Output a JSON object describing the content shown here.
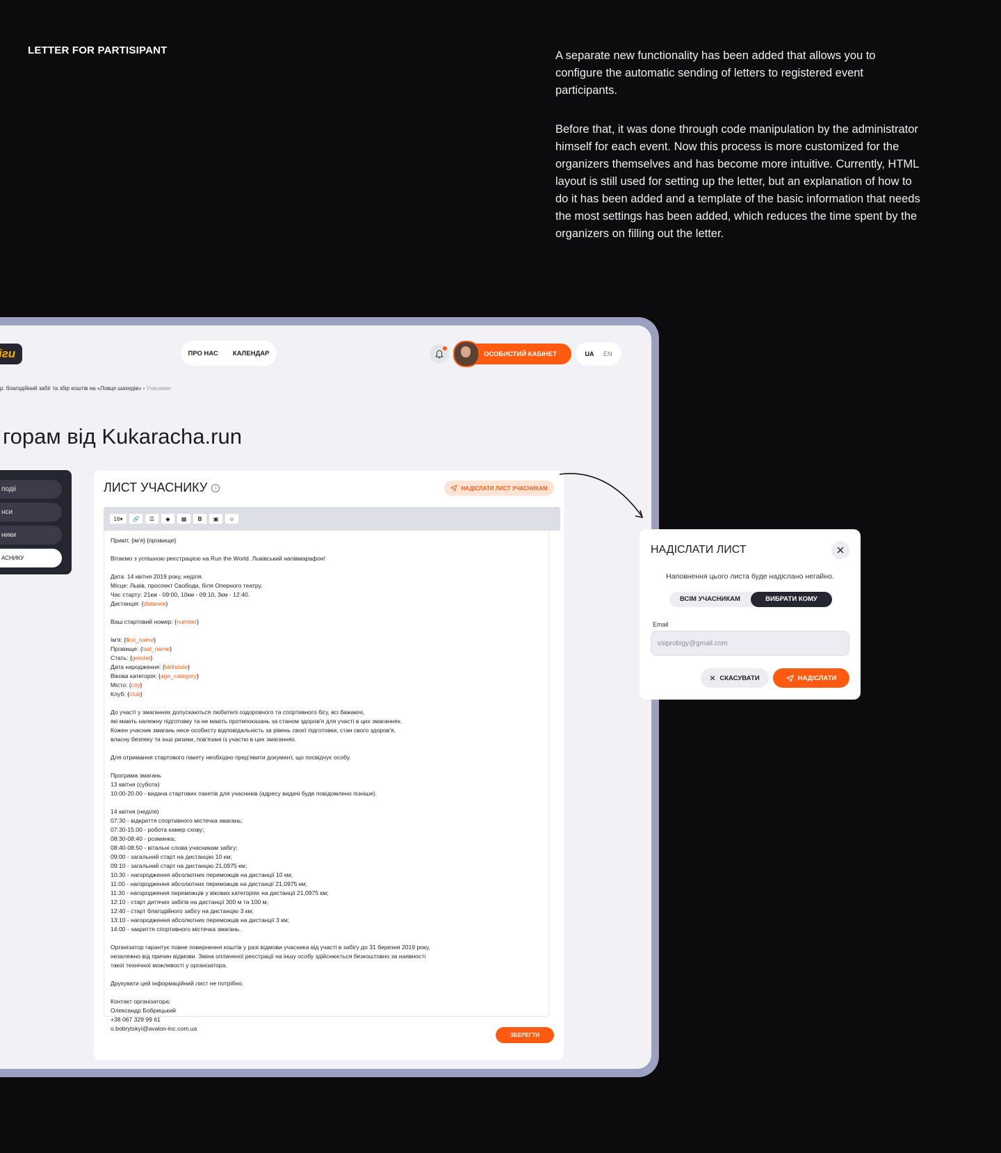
{
  "section": {
    "title": "LETTER FOR PARTISIPANT"
  },
  "intro": {
    "p1": "A separate new functionality has been added that allows you to configure the automatic sending of letters to registered event participants.",
    "p2": "Before that, it was done through code manipulation by the administrator himself for each event. Now this process is more customized for the organizers themselves and has become more intuitive. Currently, HTML layout is still used for setting up the letter, but an explanation of how to do it has been added and a template of the basic information that needs the most settings has been added, which reduces the time spent by the organizers on filling out the letter."
  },
  "app": {
    "logo": "іги",
    "nav": [
      "ПРО НАС",
      "КАЛЕНДАР"
    ],
    "cabinet_label": "ОСОБИСТИЙ КАБІНЕТ",
    "lang": {
      "active": "UA",
      "other": "EN"
    },
    "breadcrumb": {
      "current": "р: благодійний забіг та збір коштів на «Ловця шахедів»",
      "separator": "›",
      "last": "Учасники"
    },
    "page_title": "горам від Kukaracha.run",
    "side_menu": [
      "подіі",
      "нси",
      "ники",
      "АСНИКУ"
    ]
  },
  "editor": {
    "title": "ЛИСТ УЧАСНИКУ",
    "send_all_label": "НАДІСЛАТИ ЛИСТ УЧАСНИКАМ",
    "font_size": "16",
    "save_label": "ЗБЕРЕГТИ",
    "lines": [
      "Привіт, {ім'я} {прізвище}",
      "",
      "Вітаємо з успішною реєстрацією на Run the World. Львівський напівмарафон!",
      "",
      "Дата: 14 квітня 2019 року, неділя.",
      "Місце: Львів, проспект Свободи, біля Оперного театру.",
      "Час старту: 21км - 09:00, 10км - 09:10, 3км - 12:40.",
      "Дистанція: {distance}",
      "",
      "Ваш стартовий номер: {number}",
      "",
      "Ім'я: {first_name}",
      "Прізвище: {last_name}",
      "Стать: {gender}",
      "Дата народження: {birthdate}",
      "Вікова категорія: {age_category}",
      "Місто: {city}",
      "Клуб: {club}",
      "",
      "До участі у змаганнях допускаються любителі оздоровчого та спортивного бігу, всі бажаючі,",
      "які мають належну підготовку та не мають протипоказань за станом здоров'я для участі в цих змаганнях.",
      "Кожен учасник змагань несе особисту відповідальність за рівень своєї підготовки, стан свого здоров'я,",
      "власну безпеку та інші ризики, пов'язані із участю в цих змаганнях.",
      "",
      "Для отримання стартового пакету необхідно пред'явити документ, що посвідчує особу.",
      "",
      "Програма змагань",
      "13 квітня (субота)",
      "10:00-20.00 - видача стартових пакетів для учасників (адресу видачі буде повідомлено пізніше).",
      "",
      "14 квітня (неділя)",
      "07:30 - відкриття спортивного містечка змагань;",
      "07:30-15:00 - робота камер схову;",
      "08:30-08:40 - розминка;",
      "08:40-08:50 - вітальні слова учасникам забігу;",
      "09:00 - загальний старт на дистанцію 10 км;",
      "09:10 - загальний старт на дистанцію 21,0975 км;",
      "10:30 - нагородження абсолютних переможців на дистанції 10 км;",
      "11:00 - нагородження абсолютних переможців на дистанції 21,0975 км;",
      "11:30 - нагородження переможців у вікових категоріях на дистанції 21,0975 км;",
      "12:10 - старт дитячих забігів на дистанції 300 м та 100 м;",
      "12:40 - старт благодійного забігу на дистанцію 3 км;",
      "13:10 - нагородження абсолютних переможців на дистанції 3 км;",
      "14:00 - закриття спортивного містечка змагань.",
      "",
      "Організатор гарантує повне повернення коштів у разі відмови учасника від участі в забігу до 31 березня 2019 року,",
      "незалежно від причин відмови. Зміна оплаченої реєстрації на іншу особу здійснюється безкоштовно за наявності",
      "такої технічної можливості у організатора.",
      "",
      "Друкувати цей інформаційний лист не потрібно.",
      "",
      "Контакт організатора:",
      "Олександр Бобрицький",
      "+38 067 329 99 61",
      "o.bobrytskyi@avalon-inc.com.ua"
    ]
  },
  "modal": {
    "title": "НАДІСЛАТИ ЛИСТ",
    "description": "Наповнення цього листа буде надіслано негайно.",
    "options": [
      "ВСІМ УЧАСНИКАМ",
      "ВИБРАТИ КОМУ"
    ],
    "selected_option": "ВИБРАТИ КОМУ",
    "email_label": "Email",
    "email_value": "vsiprobigy@gmail.com",
    "cancel_label": "СКАСУВАТИ",
    "send_label": "НАДІСЛАТИ"
  },
  "colors": {
    "accent": "#ff5a12",
    "dark": "#262631",
    "background": "#0c0c0e",
    "frame": "#9ca0c0"
  }
}
